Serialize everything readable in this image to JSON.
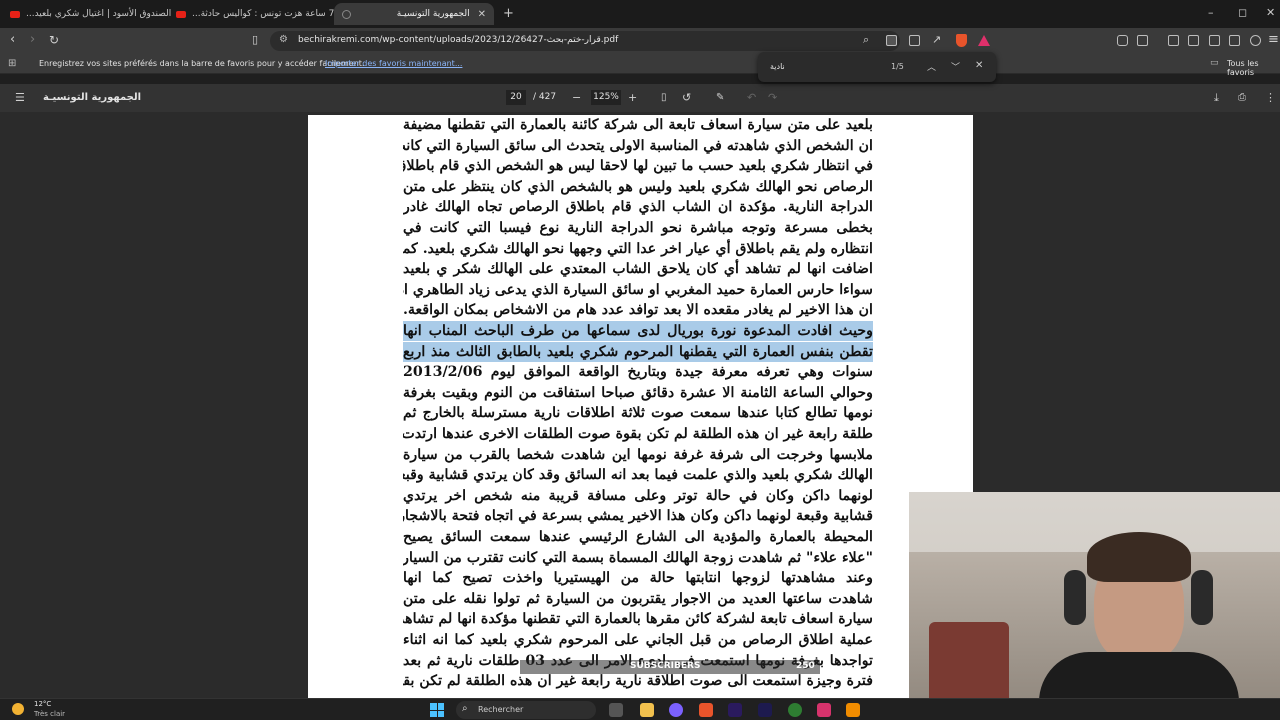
{
  "browser": {
    "tabs": [
      {
        "label": "الصندوق الأسود | اغتيال شكري بلعيد...",
        "active": false
      },
      {
        "label": "(2) 72 ساعة هزت تونس : كواليس حادثة...",
        "active": false
      },
      {
        "label": "الجمهورية التونسيـة",
        "active": true
      }
    ],
    "new_tab": "+",
    "window_controls": [
      "–",
      "◻",
      "✕"
    ],
    "url": "bechirakremi.com/wp-content/uploads/2023/12/26427-قرار-ختم-بحث.pdf",
    "bookmarks_message": "Enregistrez vos sites préférés dans la barre de favoris pour y accéder facilement.",
    "bookmarks_link": "Importer des favoris maintenant...",
    "all_favorites": "Tous les favoris"
  },
  "find": {
    "query": "نادية",
    "count": "1/5"
  },
  "pdf": {
    "doc_title": "الجمهورية التونسيـة",
    "page_current": "20",
    "page_total": "/ 427",
    "zoom": "125%",
    "lines": [
      {
        "text": "بلعيد على متن سيارة اسعاف تابعة الى شركة كائنة بالعمارة التي تقطنها مضيفة",
        "hl": false
      },
      {
        "text": "ان الشخص الذي شاهدته في المناسبة الاولى يتحدث الى سائق السيارة التي كانت",
        "hl": false
      },
      {
        "text": "في انتظار شكري بلعيد حسب ما تبين لها لاحقا ليس هو الشخص الذي قام باطلاق",
        "hl": false
      },
      {
        "text": "الرصاص نحو الهالك شكري بلعيد وليس هو بالشخص الذي كان ينتظر على متن",
        "hl": false
      },
      {
        "text": "الدراجة النارية. مؤكدة ان الشاب الذي قام باطلاق الرصاص تجاه الهالك غادر",
        "hl": false
      },
      {
        "text": "بخطى مسرعة وتوجه مباشرة نحو الدراجة النارية نوع فيسبا التي كانت في",
        "hl": false
      },
      {
        "text": "انتظاره ولم يقم باطلاق أي عيار اخر عدا التي وجهها نحو الهالك شكري بلعيد. كما",
        "hl": false
      },
      {
        "text": "اضافت انها لم تشاهد أي كان يلاحق الشاب المعتدي على الهالك شكر ي بلعيد",
        "hl": false
      },
      {
        "text": "سواءا حارس العمارة حميد المغربي او سائق السيارة الذي يدعى زياد الطاهري اذ",
        "hl": false
      },
      {
        "text": "ان هذا الاخير لم يغادر مقعده الا بعد توافد عدد هام من الاشخاص بمكان الواقعة.",
        "hl": false
      },
      {
        "text": "وحيث افادت المدعوة نورة بوريال لدى سماعها من طرف الباحث المناب انها",
        "hl": true
      },
      {
        "text": "تقطن بنفس العمارة التي يقطنها المرحوم شكري بلعيد بالطابق الثالث منذ اربع",
        "hl": true
      },
      {
        "text": "سنوات وهي تعرفه معرفة جيدة وبتاريخ الواقعة الموافق ليوم 2013/2/06",
        "hl": false
      },
      {
        "text": "وحوالي الساعة الثامنة الا عشرة دقائق صباحا استفاقت من النوم وبقيت بغرفة",
        "hl": false
      },
      {
        "text": "نومها تطالع كتابا عندها سمعت صوت ثلاثة اطلاقات نارية مسترسلة بالخارج ثم",
        "hl": false
      },
      {
        "text": "طلقة رابعة غير ان هذه الطلقة لم تكن بقوة صوت الطلقات الاخرى عندها ارتدت",
        "hl": false
      },
      {
        "text": "ملابسها وخرجت الى شرفة غرفة نومها اين شاهدت شخصا بالقرب من سيارة",
        "hl": false
      },
      {
        "text": "الهالك شكري بلعيد والذي علمت فيما بعد انه السائق وقد كان يرتدي قشابية وقبعة",
        "hl": false
      },
      {
        "text": "لونهما داكن وكان في حالة توتر وعلى مسافة قريبة منه شخص اخر يرتدي",
        "hl": false
      },
      {
        "text": "قشابية وقبعة لونهما داكن وكان هذا الاخير يمشي بسرعة في اتجاه فتحة بالاشجار",
        "hl": false
      },
      {
        "text": "المحيطة بالعمارة والمؤدية الى الشارع الرئيسي عندها سمعت السائق يصيح",
        "hl": false
      },
      {
        "text": "\"علاء علاء\" ثم شاهدت زوجة الهالك المسماة بسمة التي كانت تقترب من السيارة",
        "hl": false
      },
      {
        "text": "وعند مشاهدتها لزوجها انتابتها حالة من الهيستيريا واخذت تصيح كما انها",
        "hl": false
      },
      {
        "text": "شاهدت ساعتها العديد من الاجوار يقتربون من السيارة ثم تولوا نقله على متن",
        "hl": false
      },
      {
        "text": "سيارة اسعاف تابعة لشركة كائن مقرها بالعمارة التي تقطنها مؤكدة انها لم تشاهد",
        "hl": false
      },
      {
        "text": "عملية اطلاق الرصاص من قبل الجاني على المرحوم شكري بلعيد كما انه اثناء",
        "hl": false
      },
      {
        "text": "تواجدها بغرفة نومها استمعت في بادىء الامر الى عدد 03 طلقات نارية ثم بعد",
        "hl": false
      },
      {
        "text": "فترة وجيزة استمعت الى صوت اطلاقة نارية رابعة غير ان هذه الطلقة لم تكن بقوة",
        "hl": false
      }
    ]
  },
  "overlay": {
    "subscribers_label": "SUBSCRIBERS",
    "subscribers_count": "250"
  },
  "taskbar": {
    "weather_temp": "12°C",
    "weather_desc": "Très clair",
    "search_placeholder": "Rechercher"
  },
  "colors": {
    "highlight": "#a9cbe8",
    "youtube": "#e62117",
    "link": "#8ab4f8"
  }
}
